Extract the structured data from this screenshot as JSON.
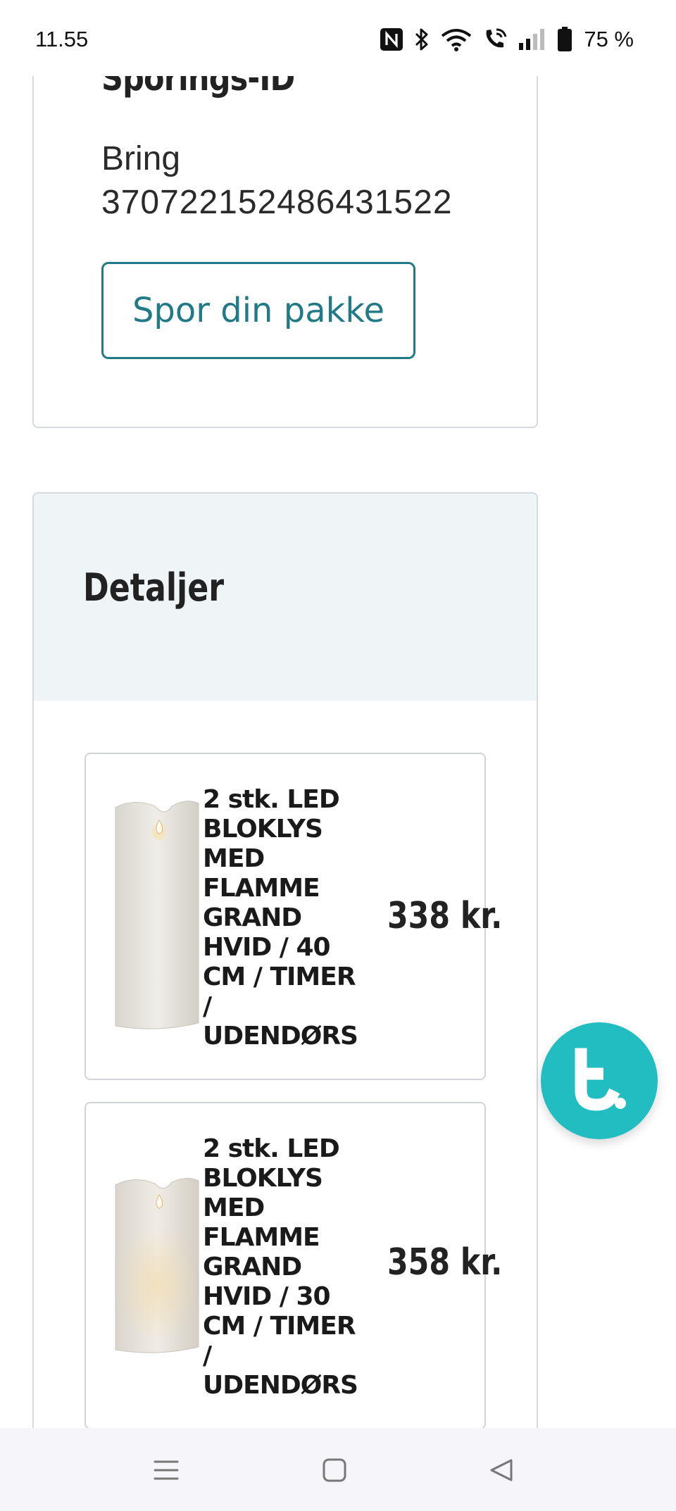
{
  "status_bar": {
    "time": "11.55",
    "battery_percent": "75 %",
    "icons": [
      "nfc-icon",
      "bluetooth-icon",
      "wifi-icon",
      "wifi-call-icon",
      "signal-icon",
      "battery-icon"
    ]
  },
  "tracking": {
    "heading": "Sporings-ID",
    "carrier": "Bring",
    "tracking_number": "370722152486431522",
    "button_label": "Spor din pakke"
  },
  "details": {
    "title": "Detaljer",
    "items": [
      {
        "name": "2 stk. LED BLOKLYS MED FLAMME GRAND HVID / 40 CM / TIMER / UDENDØRS",
        "price": "338 kr."
      },
      {
        "name": "2 stk. LED BLOKLYS MED FLAMME GRAND HVID / 30 CM / TIMER / UDENDØRS",
        "price": "358 kr."
      }
    ]
  },
  "colors": {
    "accent": "#217a85",
    "chat_bubble": "#22bdc0",
    "details_header_bg": "#eff4f7",
    "border": "#d6d9dd"
  },
  "navigation": {
    "icons": [
      "menu-icon",
      "home-icon",
      "back-icon"
    ]
  }
}
